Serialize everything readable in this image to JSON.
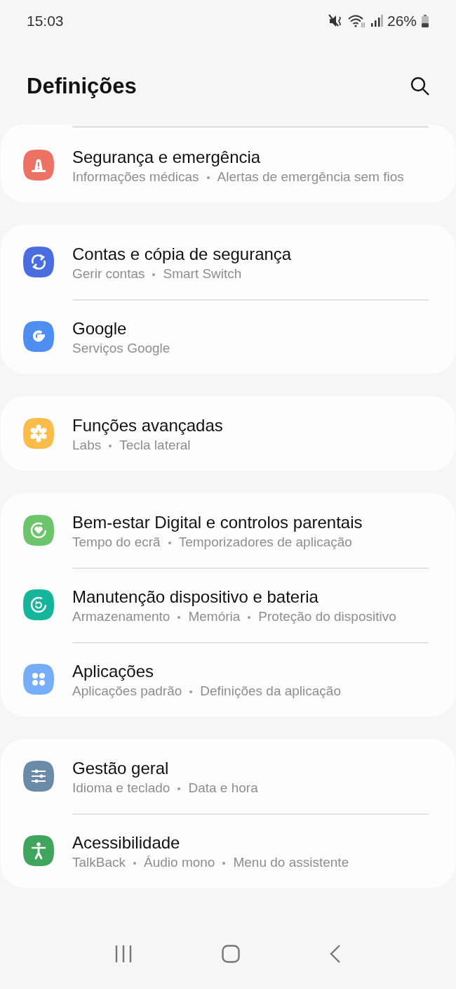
{
  "status_bar": {
    "time": "15:03",
    "battery": "26%"
  },
  "header": {
    "title": "Definições"
  },
  "groups": [
    {
      "top_divider": true,
      "items": [
        {
          "kind": "warning",
          "color": "#ec7364",
          "title": "Segurança e emergência",
          "details": [
            "Informações médicas",
            "Alertas de emergência sem fios"
          ]
        }
      ]
    },
    {
      "top_divider": false,
      "items": [
        {
          "kind": "sync",
          "color": "#4a6ee0",
          "title": "Contas e cópia de segurança",
          "details": [
            "Gerir contas",
            "Smart Switch"
          ]
        },
        {
          "kind": "google",
          "color": "#4e8ef0",
          "title": "Google",
          "details": [
            "Serviços Google"
          ]
        }
      ]
    },
    {
      "top_divider": false,
      "items": [
        {
          "kind": "gear",
          "color": "#fbbc4a",
          "title": "Funções avançadas",
          "details": [
            "Labs",
            "Tecla lateral"
          ]
        }
      ]
    },
    {
      "top_divider": false,
      "items": [
        {
          "kind": "heart",
          "color": "#6cc46b",
          "title": "Bem-estar Digital e controlos parentais",
          "details": [
            "Tempo do ecrã",
            "Temporizadores de aplicação"
          ]
        },
        {
          "kind": "care",
          "color": "#15b59b",
          "title": "Manutenção dispositivo e bateria",
          "details": [
            "Armazenamento",
            "Memória",
            "Proteção do dispositivo"
          ]
        },
        {
          "kind": "apps",
          "color": "#75aef7",
          "title": "Aplicações",
          "details": [
            "Aplicações padrão",
            "Definições da aplicação"
          ]
        }
      ]
    },
    {
      "top_divider": false,
      "items": [
        {
          "kind": "sliders",
          "color": "#6a8aa8",
          "title": "Gestão geral",
          "details": [
            "Idioma e teclado",
            "Data e hora"
          ]
        },
        {
          "kind": "person",
          "color": "#3fa45e",
          "title": "Acessibilidade",
          "details": [
            "TalkBack",
            "Áudio mono",
            "Menu do assistente"
          ]
        }
      ]
    }
  ]
}
